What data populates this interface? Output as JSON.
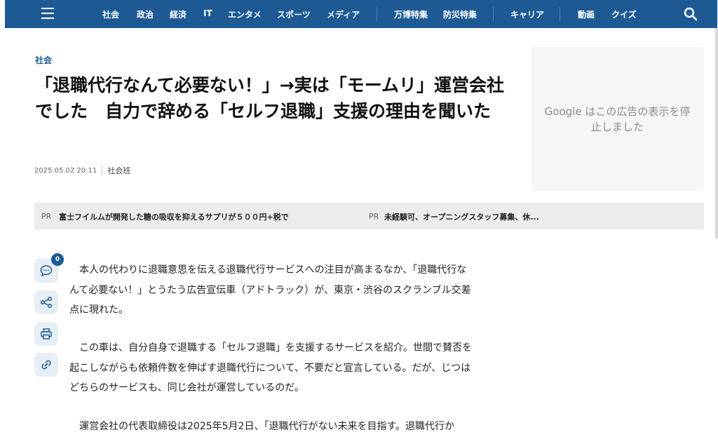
{
  "nav": {
    "items": [
      "社会",
      "政治",
      "経済",
      "IT",
      "エンタメ",
      "スポーツ",
      "メディア",
      "万博特集",
      "防災特集",
      "キャリア",
      "動画",
      "クイズ"
    ]
  },
  "article": {
    "category": "社会",
    "title": "「退職代行なんて必要ない！」→実は「モームリ」運営会社でした　自力で辞める「セルフ退職」支援の理由を聞いた",
    "date": "2025.05.02 20:11",
    "author": "社会班",
    "comment_count": "0",
    "paragraphs": [
      "本人の代わりに退職意思を伝える退職代行サービスへの注目が高まるなか、「退職代行なんて必要ない！」とうたう広告宣伝車（アドトラック）が、東京・渋谷のスクランブル交差点に現れた。",
      "この車は、自分自身で退職する「セルフ退職」を支援するサービスを紹介。世間で賛否を起こしながらも依頼件数を伸ばす退職代行について、不要だと宣言している。だが、じつはどちらのサービスも、同じ会社が運営しているのだ。",
      "運営会社の代表取締役は2025年5月2日、「退職代行がない未来を目指す。退職代行か"
    ]
  },
  "ad": {
    "text": "Google はこの広告の表示を停止しました"
  },
  "pr": [
    {
      "label": "PR",
      "text": "富士フイルムが開発した糖の吸収を抑えるサプリが５００円+税で"
    },
    {
      "label": "PR",
      "text": "未経験可、オープニングスタッフ募集、休..."
    }
  ],
  "icons": {
    "menu": "hamburger-menu-icon",
    "search": "search-icon",
    "comment": "comment-icon",
    "share": "share-icon",
    "print": "print-icon",
    "link": "link-icon"
  },
  "colors": {
    "nav_bg": "#1d5a94",
    "accent": "#1d5a94",
    "rail_bg": "#e6eef6",
    "pr_bg": "#ececec"
  }
}
